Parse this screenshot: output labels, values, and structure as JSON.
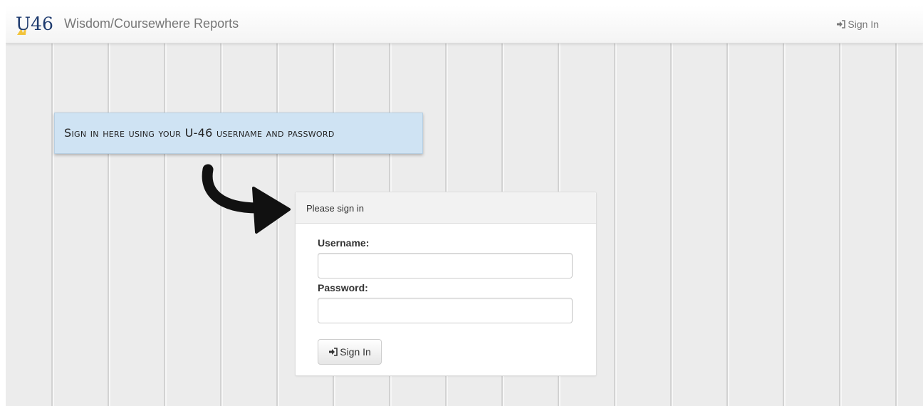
{
  "navbar": {
    "logo_text": "U46",
    "brand": "Wisdom/Coursewhere Reports",
    "signin_label": "Sign In",
    "signin_icon": "sign-in-icon"
  },
  "callout": {
    "text": "Sign in here using your U-46 username and password",
    "arrow_icon": "curved-arrow-icon"
  },
  "login_panel": {
    "title": "Please sign in",
    "username_label": "Username:",
    "username_value": "",
    "password_label": "Password:",
    "password_value": "",
    "submit_label": "Sign In",
    "submit_icon": "sign-in-icon"
  },
  "colors": {
    "callout_bg": "#cfe3f3",
    "brand_text": "#777777",
    "logo_navy": "#1d3a6e",
    "logo_gold": "#f2c33a",
    "wall": "#ececec"
  }
}
